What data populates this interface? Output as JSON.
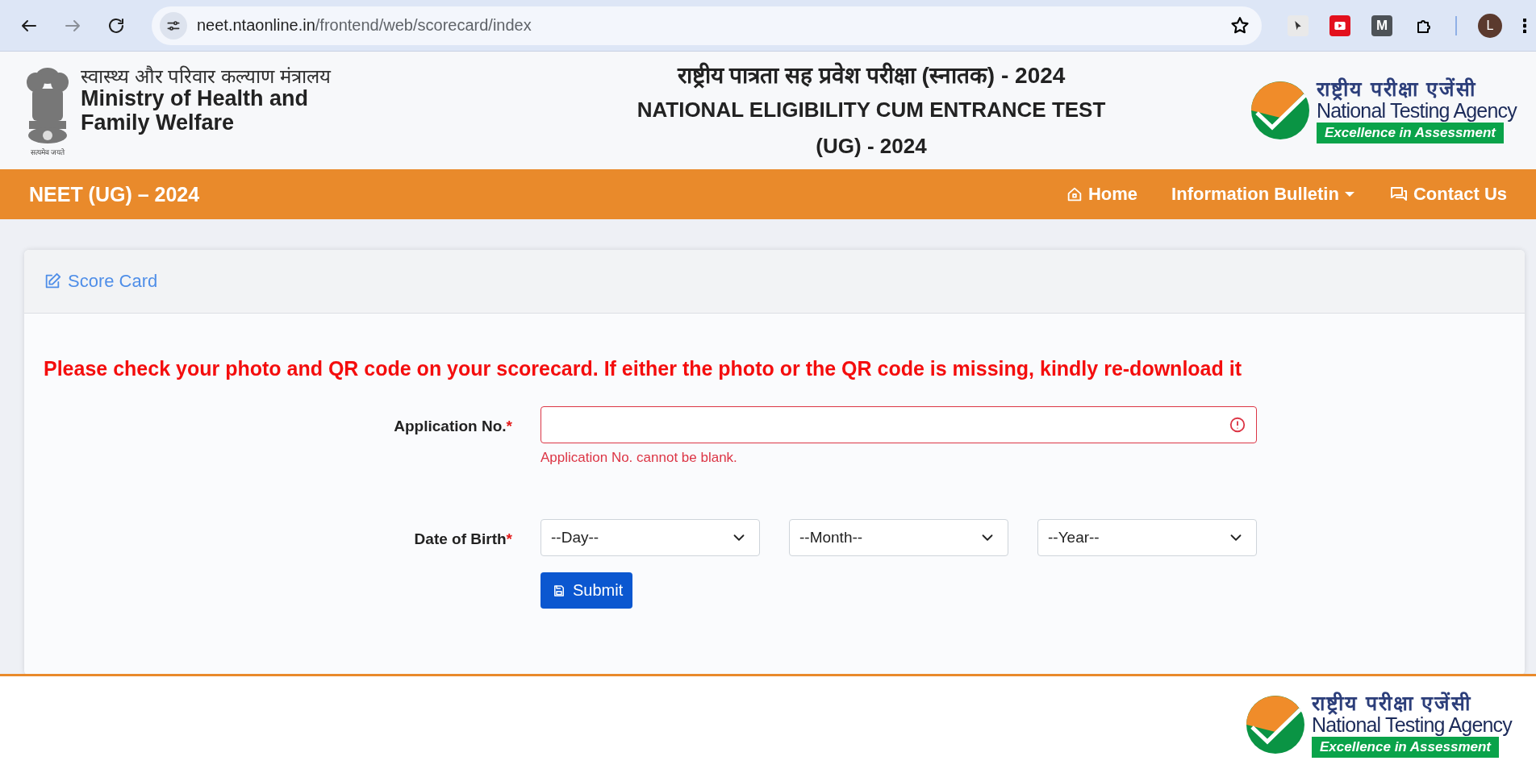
{
  "browser": {
    "nav_buttons": [
      {
        "kind": "back",
        "disabled": false
      },
      {
        "kind": "forward",
        "disabled": true
      },
      {
        "kind": "reload",
        "disabled": false
      }
    ],
    "url_host": "neet.ntaonline.in",
    "url_path": "/frontend/web/scorecard/index",
    "extensions": [
      {
        "kind": "cursor"
      },
      {
        "kind": "play"
      },
      {
        "kind": "letter",
        "text": "M"
      },
      {
        "kind": "puzzle"
      }
    ],
    "profile_initial": "L"
  },
  "header": {
    "emblem_motto": "सत्यमेव जयते",
    "ministry_hindi": "स्वास्थ्य और परिवार कल्याण मंत्रालय",
    "ministry_english": [
      "Ministry of Health and",
      "Family Welfare"
    ],
    "title_hindi": "राष्ट्रीय पात्रता सह प्रवेश परीक्षा (स्नातक) - 2024",
    "title_english": [
      "NATIONAL ELIGIBILITY CUM ENTRANCE TEST",
      "(UG) - 2024"
    ],
    "logo": {
      "hindi": "राष्ट्रीय परीक्षा एजेंसी",
      "english": "National Testing Agency",
      "tagline": "Excellence in Assessment"
    }
  },
  "nav": {
    "brand": "NEET (UG) – 2024",
    "items": [
      {
        "label": "Home",
        "kind": "home"
      },
      {
        "label": "Information Bulletin",
        "kind": "dropdown"
      },
      {
        "label": "Contact Us",
        "kind": "contact"
      }
    ]
  },
  "card": {
    "title": "Score Card",
    "notice": "Please check your photo and QR code on your scorecard. If either the photo or the QR code is missing, kindly re-download it",
    "fields": [
      {
        "label": "Application No.",
        "required_mark": "*",
        "kind": "text",
        "invalid": true,
        "error": "Application No. cannot be blank."
      },
      {
        "label": "Date of Birth",
        "required_mark": "*",
        "kind": "selects",
        "options": [
          "--Day--",
          "--Month--",
          "--Year--"
        ]
      }
    ],
    "submit": "Submit"
  },
  "footer": {
    "logo": {
      "hindi": "राष्ट्रीय परीक्षा एजेंसी",
      "english": "National Testing Agency",
      "tagline": "Excellence in Assessment"
    }
  }
}
